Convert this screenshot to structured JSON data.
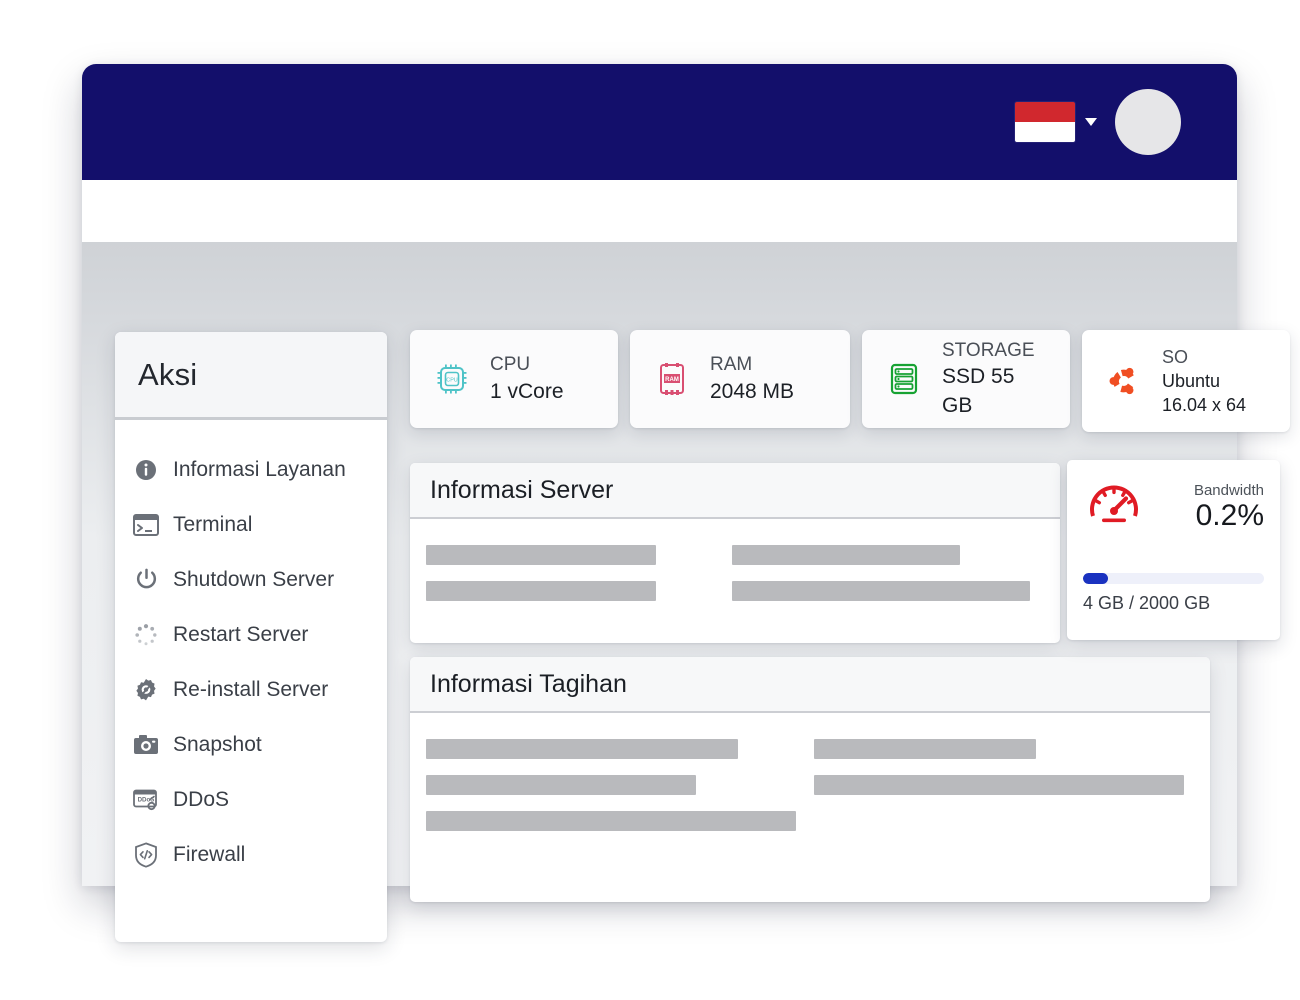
{
  "navbar": {
    "flag_icon": "indonesia-flag-icon",
    "flag_colors": {
      "top": "#d1282e",
      "bottom": "#ffffff"
    },
    "caret_icon": "chevron-down-icon",
    "avatar_icon": "user-avatar",
    "background": "#130f6b"
  },
  "sidebar": {
    "title": "Aksi",
    "items": [
      {
        "label": "Informasi Layanan",
        "icon": "info-circle-icon"
      },
      {
        "label": "Terminal",
        "icon": "terminal-icon"
      },
      {
        "label": "Shutdown Server",
        "icon": "power-icon"
      },
      {
        "label": "Restart Server",
        "icon": "spinner-restart-icon"
      },
      {
        "label": "Re-install Server",
        "icon": "gear-reinstall-icon"
      },
      {
        "label": "Snapshot",
        "icon": "camera-icon"
      },
      {
        "label": "DDoS",
        "icon": "ddos-window-icon"
      },
      {
        "label": "Firewall",
        "icon": "shield-code-icon"
      }
    ]
  },
  "specs": [
    {
      "key": "cpu",
      "label": "CPU",
      "value": "1 vCore",
      "icon": "cpu-chip-icon",
      "color": "#4ec3c7"
    },
    {
      "key": "ram",
      "label": "RAM",
      "value": "2048 MB",
      "icon": "ram-stick-icon",
      "color": "#d94f72"
    },
    {
      "key": "storage",
      "label": "STORAGE",
      "value": "SSD 55 GB",
      "icon": "database-icon",
      "color": "#17a233"
    },
    {
      "key": "so",
      "label": "SO",
      "value": "Ubuntu",
      "value2": "16.04 x 64",
      "icon": "ubuntu-logo-icon",
      "color": "#f04e23"
    }
  ],
  "panels": {
    "server": {
      "title": "Informasi Server"
    },
    "billing": {
      "title": "Informasi Tagihan"
    }
  },
  "bandwidth": {
    "gauge_icon": "speedometer-icon",
    "gauge_color": "#e01b24",
    "label": "Bandwidth",
    "percent": "0.2%",
    "percent_value": 0.2,
    "bar_fill_percent": 14,
    "bar_color": "#1a32c0",
    "usage": "4 GB / 2000 GB",
    "used_gb": 4,
    "total_gb": 2000
  }
}
